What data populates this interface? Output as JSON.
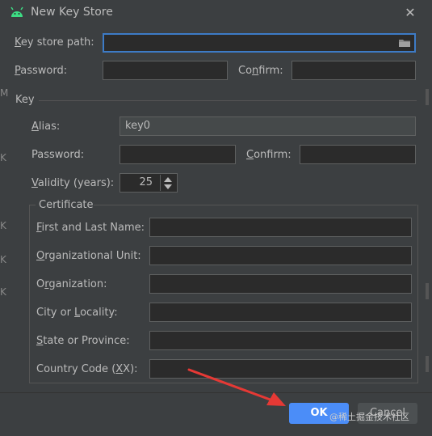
{
  "window": {
    "title": "New Key Store",
    "close_glyph": "✕"
  },
  "keystore": {
    "path_label_prefix": "K",
    "path_label_rest": "ey store path:",
    "password_label_prefix": "P",
    "password_label_rest": "assword:",
    "confirm_label_prefix": "Co",
    "confirm_label_u": "n",
    "confirm_label_rest": "firm:"
  },
  "key": {
    "section_label": "Key",
    "alias_label_prefix": "A",
    "alias_label_rest": "lias:",
    "alias_value": "key0",
    "password_label": "Password:",
    "confirm_label_prefix": "C",
    "confirm_label_rest": "onfirm:",
    "validity_label_prefix": "V",
    "validity_label_rest": "alidity (years):",
    "validity_value": "25"
  },
  "certificate": {
    "section_label": "Certificate",
    "fields": [
      {
        "pre": "",
        "u": "F",
        "post": "irst and Last Name:"
      },
      {
        "pre": "",
        "u": "O",
        "post": "rganizational Unit:"
      },
      {
        "pre": "O",
        "u": "r",
        "post": "ganization:"
      },
      {
        "pre": "City or ",
        "u": "L",
        "post": "ocality:"
      },
      {
        "pre": "",
        "u": "S",
        "post": "tate or Province:"
      },
      {
        "pre": "Country Code (",
        "u": "X",
        "post": "X):"
      }
    ]
  },
  "buttons": {
    "ok": "OK",
    "cancel": "Cancel"
  },
  "background": {
    "letters": [
      "M",
      "K",
      "K",
      "K",
      "K"
    ]
  },
  "watermark": "@稀土掘金技术社区",
  "colors": {
    "accent": "#4b8df8",
    "android_green": "#3ddc84",
    "arrow_red": "#e53935"
  },
  "icons": {
    "title": "android-icon",
    "browse": "folder-icon"
  }
}
